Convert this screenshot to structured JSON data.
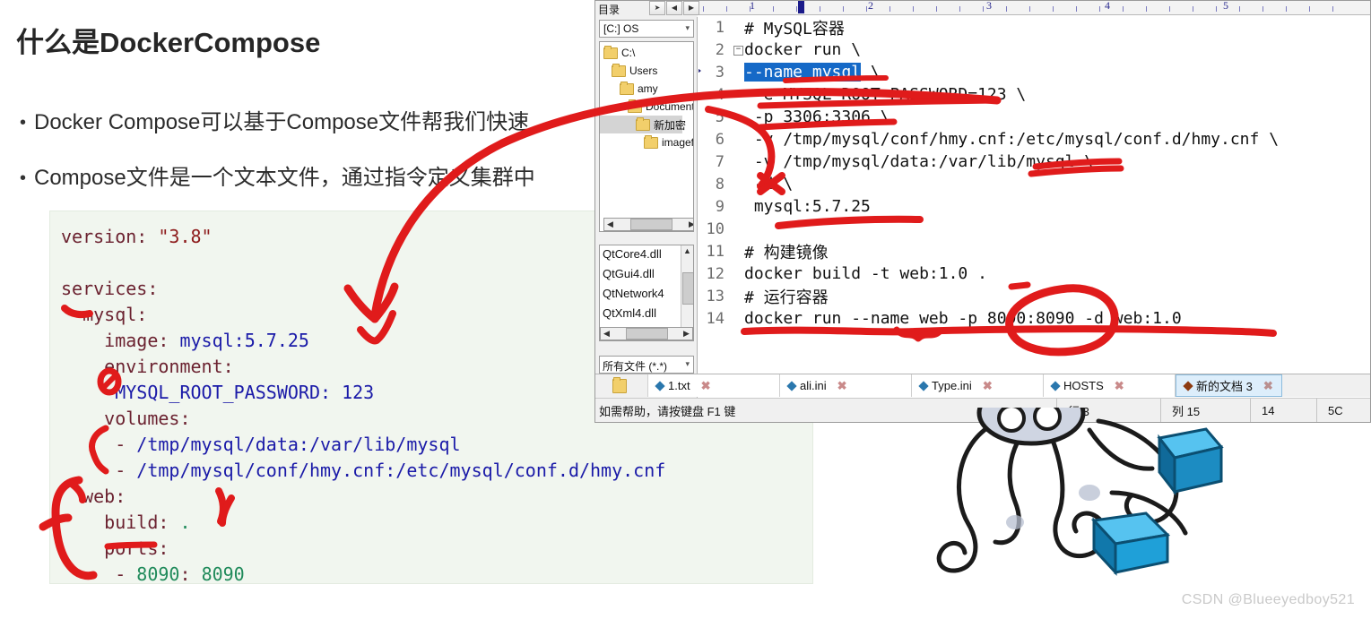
{
  "slide": {
    "title": "什么是DockerCompose",
    "bullets": [
      "Docker Compose可以基于Compose文件帮我们快速",
      "Compose文件是一个文本文件，通过指令定义集群中"
    ],
    "code_lines": [
      "version: \"3.8\"",
      "",
      "services:",
      "  mysql:",
      "    image: mysql:5.7.25",
      "    environment:",
      "     MYSQL_ROOT_PASSWORD: 123",
      "    volumes:",
      "     - /tmp/mysql/data:/var/lib/mysql",
      "     - /tmp/mysql/conf/hmy.cnf:/etc/mysql/conf.d/hmy.cnf",
      "  web:",
      "    build: .",
      "    ports:",
      "     - 8090: 8090"
    ]
  },
  "editor": {
    "directory_label": "目录",
    "nav_back": "◀",
    "nav_forward": "▶",
    "drive": "[C:] OS",
    "tree": [
      {
        "label": "C:\\",
        "indent": 0,
        "selected": false
      },
      {
        "label": "Users",
        "indent": 1,
        "selected": false
      },
      {
        "label": "amy",
        "indent": 2,
        "selected": false
      },
      {
        "label": "Document",
        "indent": 3,
        "selected": false
      },
      {
        "label": "新加密",
        "indent": 4,
        "selected": true
      },
      {
        "label": "imagefor",
        "indent": 5,
        "selected": false
      }
    ],
    "files": [
      "QtCore4.dll",
      "QtGui4.dll",
      "QtNetwork4",
      "QtXml4.dll"
    ],
    "filter": "所有文件 (*.*)",
    "ruler": [
      "1",
      "2",
      "3",
      "4",
      "5"
    ],
    "lines": [
      {
        "n": "1",
        "fold": "",
        "marker": false,
        "text": "# MySQL容器"
      },
      {
        "n": "2",
        "fold": "-",
        "marker": false,
        "text": "docker run \\"
      },
      {
        "n": "3",
        "fold": "",
        "marker": true,
        "text": "--name mysql",
        "trail": " \\",
        "selected": true
      },
      {
        "n": "4",
        "fold": "",
        "marker": false,
        "text": " -e MYSQL_ROOT_PASSWORD=123 \\"
      },
      {
        "n": "5",
        "fold": "",
        "marker": false,
        "text": " -p 3306:3306 \\"
      },
      {
        "n": "6",
        "fold": "",
        "marker": false,
        "text": " -v /tmp/mysql/conf/hmy.cnf:/etc/mysql/conf.d/hmy.cnf \\"
      },
      {
        "n": "7",
        "fold": "",
        "marker": false,
        "text": " -v /tmp/mysql/data:/var/lib/mysql \\"
      },
      {
        "n": "8",
        "fold": "",
        "marker": false,
        "text": " -d \\"
      },
      {
        "n": "9",
        "fold": "",
        "marker": false,
        "text": " mysql:5.7.25"
      },
      {
        "n": "10",
        "fold": "",
        "marker": false,
        "text": ""
      },
      {
        "n": "11",
        "fold": "",
        "marker": false,
        "text": "# 构建镜像"
      },
      {
        "n": "12",
        "fold": "",
        "marker": false,
        "text": "docker build -t web:1.0 ."
      },
      {
        "n": "13",
        "fold": "",
        "marker": false,
        "text": "# 运行容器"
      },
      {
        "n": "14",
        "fold": "",
        "marker": false,
        "text": "docker run --name web -p 8090:8090 -d web:1.0"
      }
    ],
    "tabs": [
      {
        "label": "1.txt",
        "active": false
      },
      {
        "label": "ali.ini",
        "active": false
      },
      {
        "label": "Type.ini",
        "active": false
      },
      {
        "label": "HOSTS",
        "active": false
      },
      {
        "label": "新的文档 3",
        "active": true
      }
    ],
    "status": {
      "hint": "如需帮助，请按键盘 F1 键",
      "row": "行 3",
      "col": "列 15",
      "char": "14",
      "sel": "5C"
    }
  },
  "watermark": "CSDN @Blueeyedboy521",
  "colors": {
    "annotation_red": "#e01b1b",
    "selection_blue": "#1569c7",
    "code_bg": "#f1f6ef",
    "docker_cube": "#25a3e0"
  }
}
